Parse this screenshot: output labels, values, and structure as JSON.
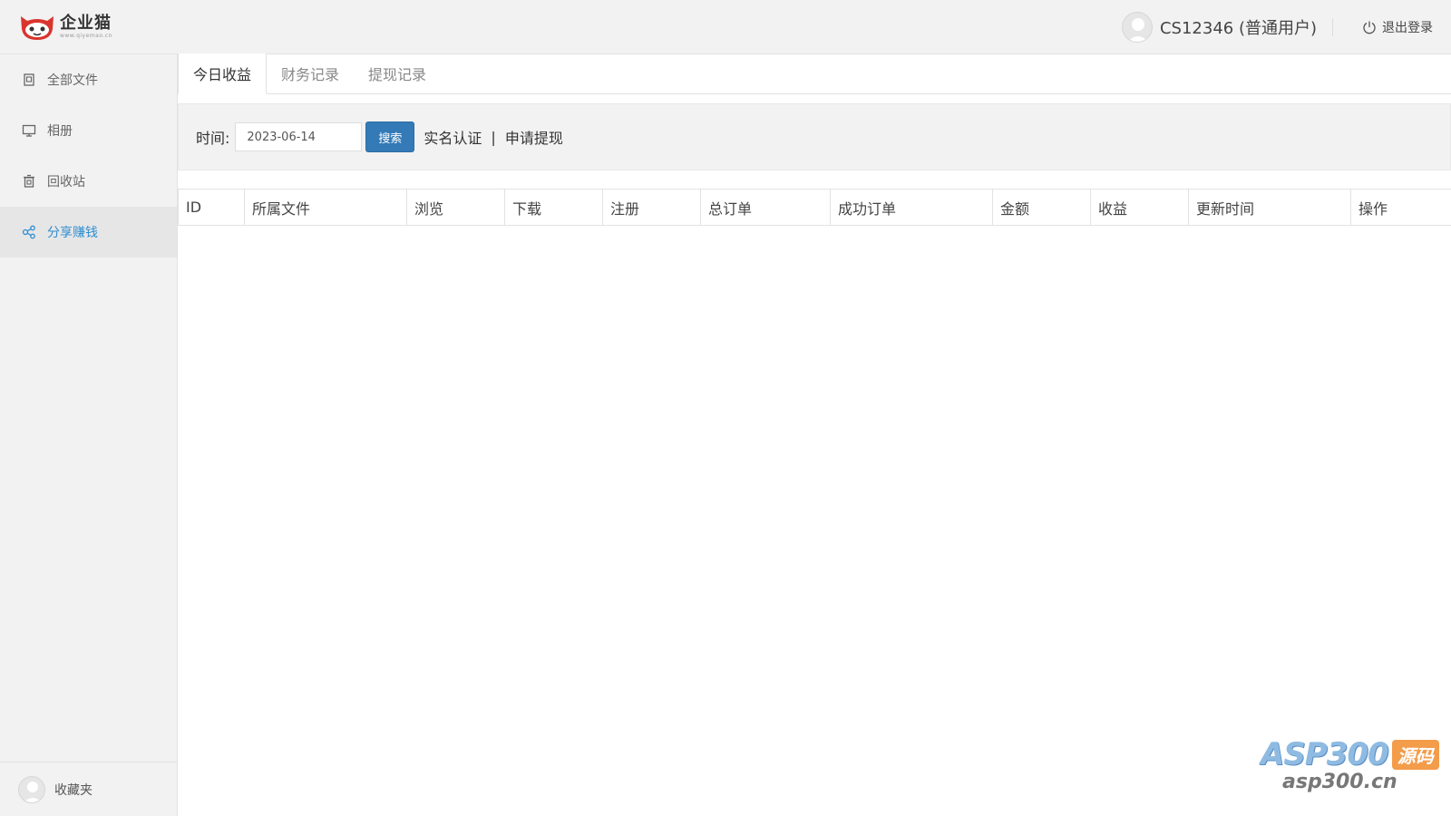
{
  "header": {
    "logo": {
      "brand": "企业猫",
      "url": "www.qiyemao.cn"
    },
    "user": {
      "name": "CS12346 (普通用户)"
    },
    "logout_label": "退出登录"
  },
  "sidebar": {
    "items": [
      {
        "label": "全部文件",
        "icon": "files-icon",
        "active": false
      },
      {
        "label": "相册",
        "icon": "monitor-icon",
        "active": false
      },
      {
        "label": "回收站",
        "icon": "trash-icon",
        "active": false
      },
      {
        "label": "分享赚钱",
        "icon": "share-icon",
        "active": true
      }
    ],
    "bottom": {
      "label": "收藏夹"
    }
  },
  "main": {
    "tabs": [
      {
        "label": "今日收益",
        "active": true
      },
      {
        "label": "财务记录",
        "active": false
      },
      {
        "label": "提现记录",
        "active": false
      }
    ],
    "filter": {
      "time_label": "时间:",
      "date_value": "2023-06-14",
      "search_label": "搜索",
      "verify_link": "实名认证",
      "separator": "|",
      "withdraw_link": "申请提现"
    },
    "table": {
      "columns": [
        "ID",
        "所属文件",
        "浏览",
        "下载",
        "注册",
        "总订单",
        "成功订单",
        "金额",
        "收益",
        "更新时间",
        "操作"
      ],
      "rows": []
    }
  },
  "watermark": {
    "brand": "ASP300",
    "badge": "源码",
    "url": "asp300.cn"
  },
  "colors": {
    "accent": "#2e8ecf",
    "button": "#337ab7",
    "watermark_badge": "#f39c4a"
  }
}
